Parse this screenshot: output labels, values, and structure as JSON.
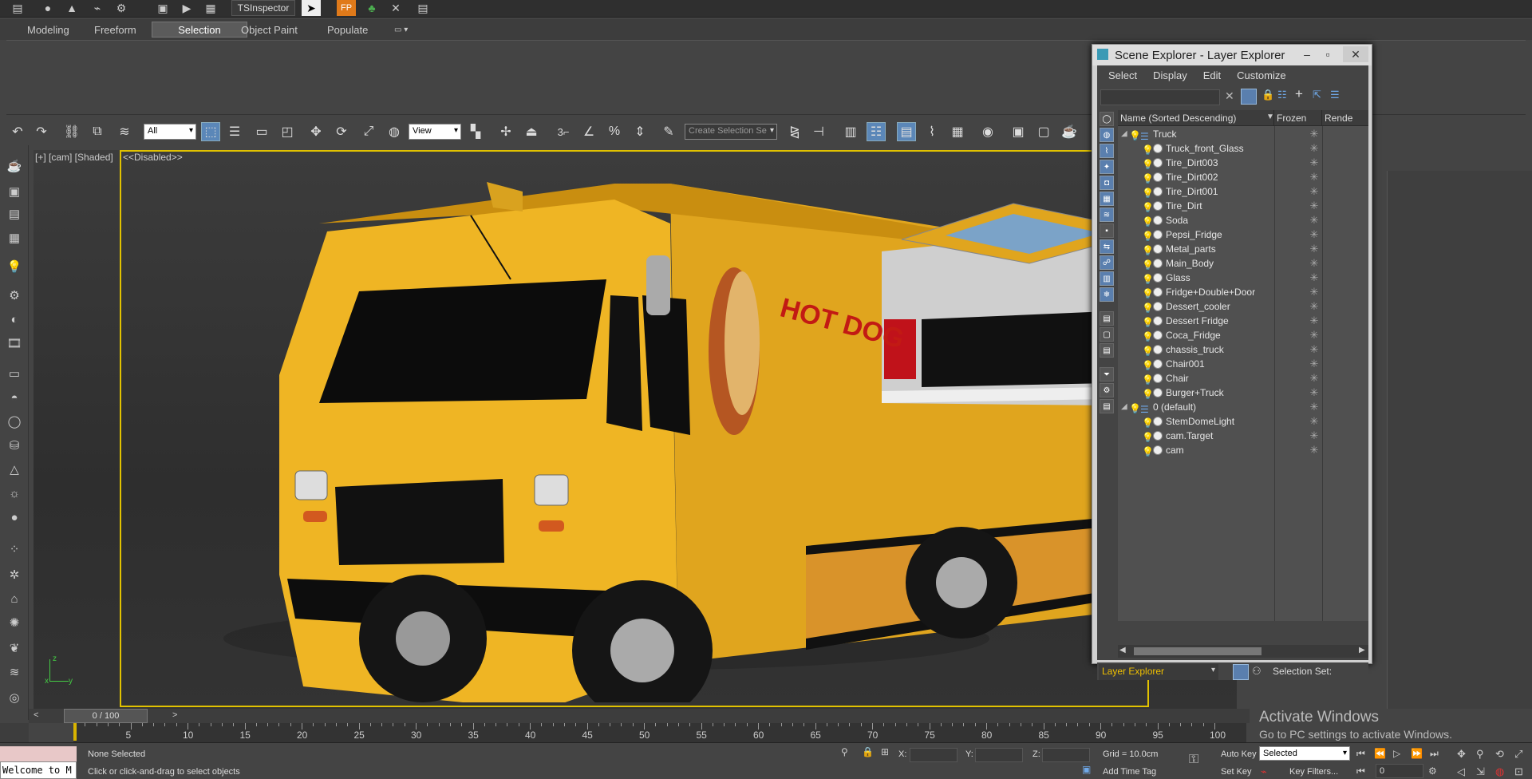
{
  "top_strip": {
    "inspector_label": "TSInspector",
    "icons": [
      "file-icon",
      "sphere-icon",
      "shirt-icon",
      "link-icon",
      "tree-icon",
      "play-icon",
      "render-icon",
      "select-arrow-icon",
      "fp-icon",
      "tree-green-icon",
      "tools-icon",
      "spreadsheet-icon"
    ]
  },
  "ribbon": {
    "tabs": [
      "Modeling",
      "Freeform",
      "Selection",
      "Object Paint",
      "Populate"
    ],
    "active_tab": "Selection"
  },
  "toolbar": {
    "filter_value": "All",
    "coord_value": "View",
    "selection_set_placeholder": "Create Selection Se",
    "snap_label": "3"
  },
  "viewport": {
    "label": "[+] [cam] [Shaded]",
    "label2": "<<Disabled>>",
    "truck_text": "HOT DOG",
    "axis_z": "z",
    "axis_x": "x",
    "axis_y": "y"
  },
  "scene_explorer": {
    "title": "Scene Explorer - Layer Explorer",
    "menu": [
      "Select",
      "Display",
      "Edit",
      "Customize"
    ],
    "columns": {
      "name": "Name (Sorted Descending)",
      "frozen": "Frozen",
      "render": "Rende"
    },
    "rows": [
      {
        "name": "Truck",
        "kind": "layer",
        "indent": 0
      },
      {
        "name": "Truck_front_Glass",
        "kind": "object",
        "indent": 1
      },
      {
        "name": "Tire_Dirt003",
        "kind": "object",
        "indent": 1
      },
      {
        "name": "Tire_Dirt002",
        "kind": "object",
        "indent": 1
      },
      {
        "name": "Tire_Dirt001",
        "kind": "object",
        "indent": 1
      },
      {
        "name": "Tire_Dirt",
        "kind": "object",
        "indent": 1
      },
      {
        "name": "Soda",
        "kind": "object",
        "indent": 1
      },
      {
        "name": "Pepsi_Fridge",
        "kind": "object",
        "indent": 1
      },
      {
        "name": "Metal_parts",
        "kind": "object",
        "indent": 1
      },
      {
        "name": "Main_Body",
        "kind": "object",
        "indent": 1
      },
      {
        "name": "Glass",
        "kind": "object",
        "indent": 1
      },
      {
        "name": "Fridge+Double+Door",
        "kind": "object",
        "indent": 1
      },
      {
        "name": "Dessert_cooler",
        "kind": "object",
        "indent": 1
      },
      {
        "name": "Dessert Fridge",
        "kind": "object",
        "indent": 1
      },
      {
        "name": "Coca_Fridge",
        "kind": "object",
        "indent": 1
      },
      {
        "name": "chassis_truck",
        "kind": "object",
        "indent": 1
      },
      {
        "name": "Chair001",
        "kind": "object",
        "indent": 1
      },
      {
        "name": "Chair",
        "kind": "object",
        "indent": 1
      },
      {
        "name": "Burger+Truck",
        "kind": "object",
        "indent": 1
      },
      {
        "name": "0 (default)",
        "kind": "layer",
        "indent": 0
      },
      {
        "name": "StemDomeLight",
        "kind": "light",
        "indent": 1
      },
      {
        "name": "cam.Target",
        "kind": "camera",
        "indent": 1
      },
      {
        "name": "cam",
        "kind": "camera",
        "indent": 1
      }
    ],
    "footer_dropdown": "Layer Explorer",
    "footer_selection": "Selection Set:"
  },
  "timeline": {
    "slider": "0 / 100",
    "ticks": [
      "5",
      "10",
      "15",
      "20",
      "25",
      "30",
      "35",
      "40",
      "45",
      "50",
      "55",
      "60",
      "65",
      "70",
      "75",
      "80",
      "85",
      "90",
      "95",
      "100"
    ]
  },
  "status": {
    "selected": "None Selected",
    "prompt": "Click or click-and-drag to select objects",
    "x_label": "X:",
    "y_label": "Y:",
    "z_label": "Z:",
    "grid": "Grid = 10.0cm",
    "add_time_tag": "Add Time Tag",
    "auto_key": "Auto Key",
    "set_key": "Set Key",
    "key_mode": "Selected",
    "key_filters": "Key Filters...",
    "frame": "0",
    "welcome": "Welcome to M"
  },
  "watermark": {
    "line1": "Activate Windows",
    "line2": "Go to PC settings to activate Windows."
  }
}
